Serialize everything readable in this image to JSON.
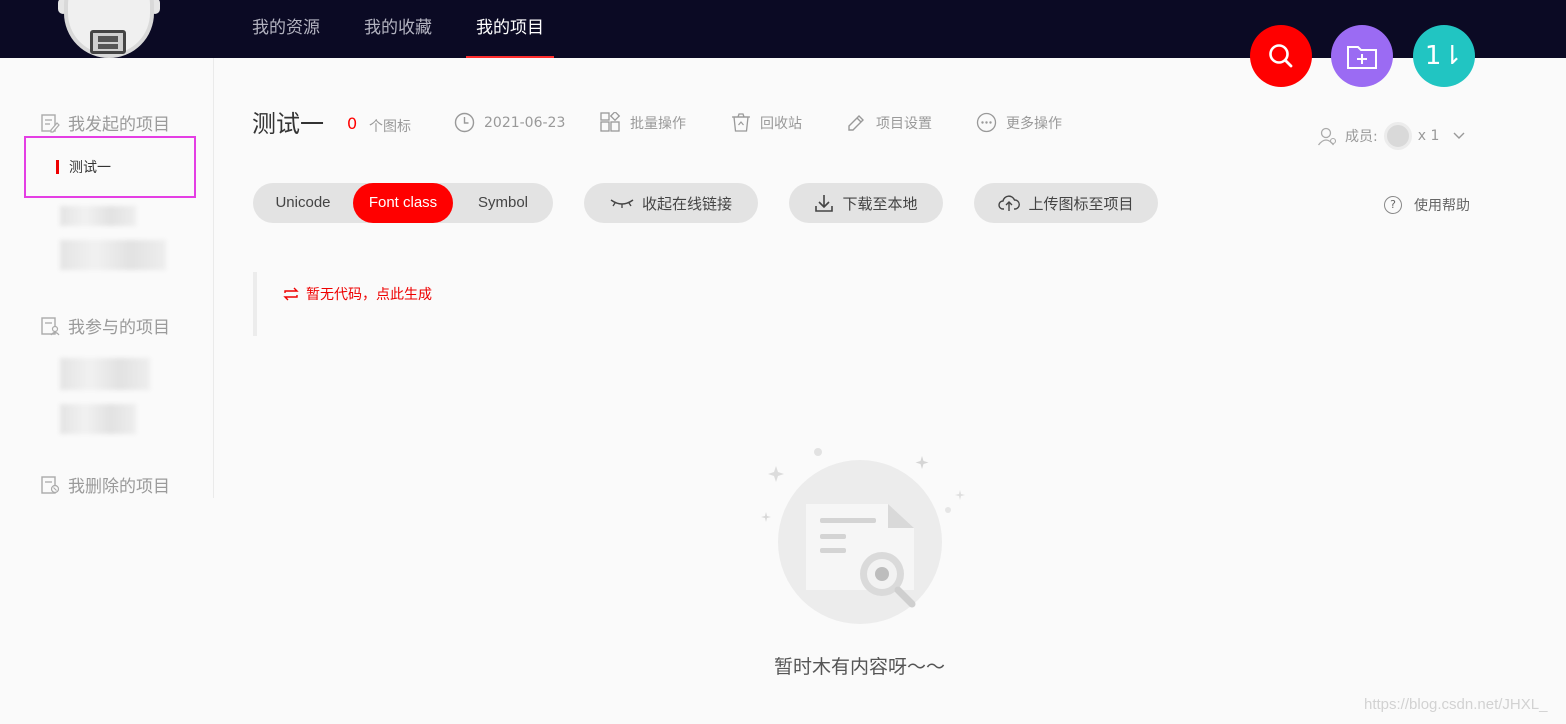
{
  "nav": {
    "items": [
      {
        "label": "我的资源",
        "active": false
      },
      {
        "label": "我的收藏",
        "active": false
      },
      {
        "label": "我的项目",
        "active": true
      }
    ]
  },
  "actions": {
    "search": "search-icon",
    "add_project": "folder-add-icon",
    "sort": "1⇂"
  },
  "sidebar": {
    "my_projects_heading": "我发起的项目",
    "selected_project": "测试一",
    "joined_projects_heading": "我参与的项目",
    "deleted_projects_heading": "我删除的项目"
  },
  "project": {
    "title": "测试一",
    "icon_count": "0",
    "icon_unit": "个图标",
    "date": "2021-06-23",
    "batch_label": "批量操作",
    "recycle_label": "回收站",
    "settings_label": "项目设置",
    "more_label": "更多操作",
    "members_label": "成员:",
    "members_count": "x 1"
  },
  "toolbar": {
    "formats": [
      {
        "label": "Unicode",
        "selected": false
      },
      {
        "label": "Font class",
        "selected": true
      },
      {
        "label": "Symbol",
        "selected": false
      }
    ],
    "collapse_link_label": "收起在线链接",
    "download_label": "下载至本地",
    "upload_label": "上传图标至项目",
    "help_label": "使用帮助"
  },
  "code": {
    "generate_label": "暂无代码，点此生成"
  },
  "empty": {
    "text": "暂时木有内容呀～～"
  },
  "watermark": "https://blog.csdn.net/JHXL_",
  "colors": {
    "topbar": "#0b0a24",
    "accent": "#ff0000",
    "purple": "#9b6bf3",
    "teal": "#21c5c2",
    "highlight_box": "#e43ee4"
  }
}
